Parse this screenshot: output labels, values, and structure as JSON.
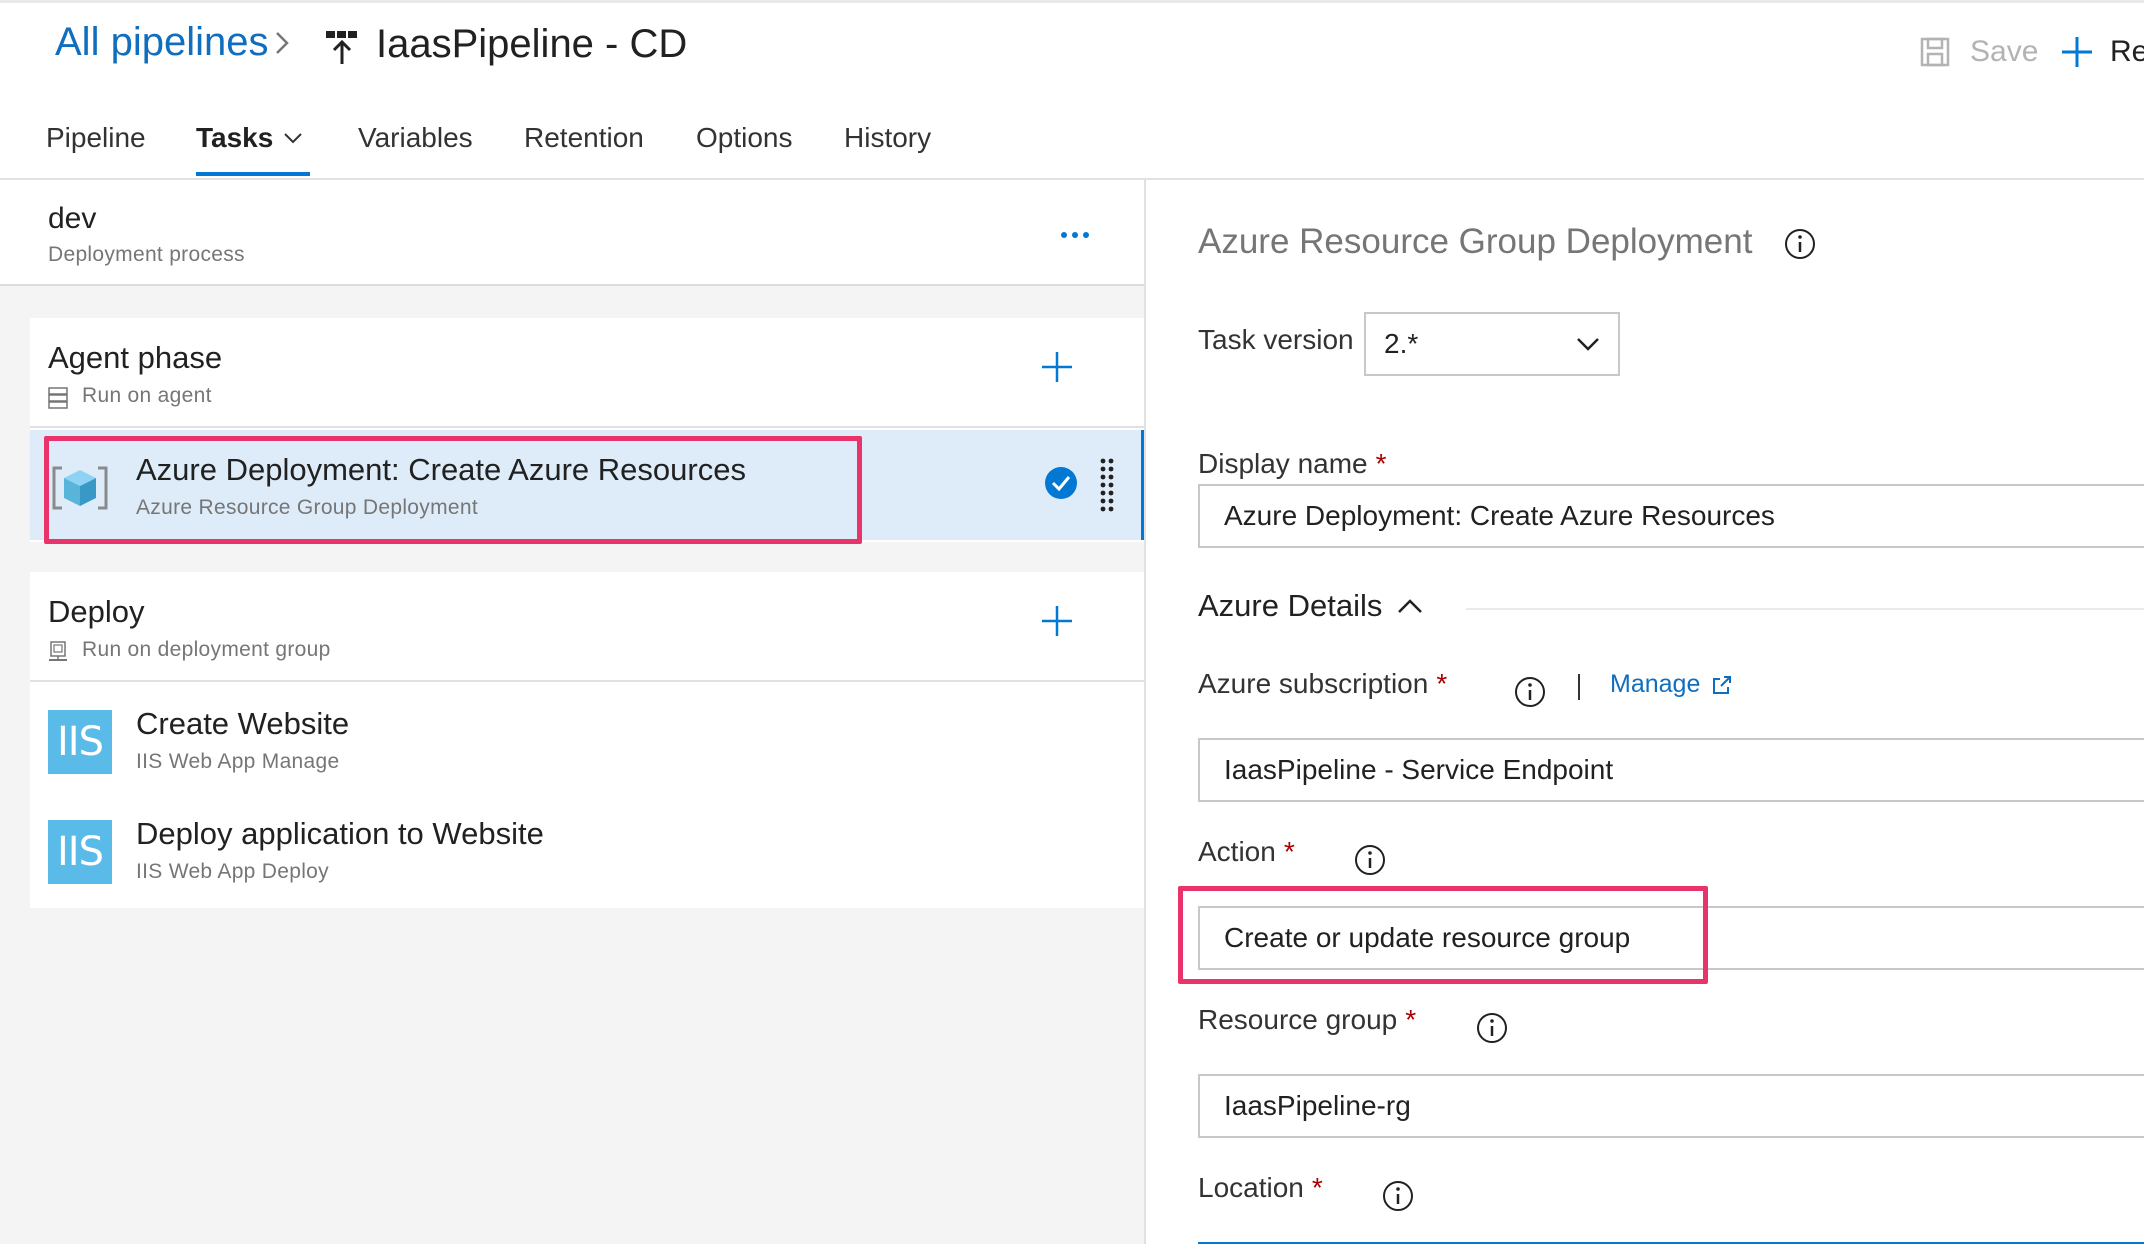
{
  "header": {
    "breadcrumb_link": "All pipelines",
    "pipeline_title": "IaasPipeline - CD",
    "save_label": "Save",
    "release_label": "Re"
  },
  "tabs": [
    "Pipeline",
    "Tasks",
    "Variables",
    "Retention",
    "Options",
    "History"
  ],
  "active_tab": "Tasks",
  "stage": {
    "name": "dev",
    "subtitle": "Deployment process"
  },
  "phases": [
    {
      "title": "Agent phase",
      "subtitle": "Run on agent",
      "tasks": [
        {
          "title": "Azure Deployment: Create Azure Resources",
          "subtitle": "Azure Resource Group Deployment",
          "selected": true
        }
      ]
    },
    {
      "title": "Deploy",
      "subtitle": "Run on deployment group",
      "tasks": [
        {
          "title": "Create Website",
          "subtitle": "IIS Web App Manage",
          "icon_text": "IIS"
        },
        {
          "title": "Deploy application to Website",
          "subtitle": "IIS Web App Deploy",
          "icon_text": "IIS"
        }
      ]
    }
  ],
  "details": {
    "title": "Azure Resource Group Deployment",
    "task_version_label": "Task version",
    "task_version_value": "2.*",
    "display_name_label": "Display name",
    "display_name_value": "Azure Deployment: Create Azure Resources",
    "section_title": "Azure Details",
    "subscription_label": "Azure subscription",
    "manage_label": "Manage",
    "subscription_value": "IaasPipeline - Service Endpoint",
    "action_label": "Action",
    "action_value": "Create or update resource group",
    "resource_group_label": "Resource group",
    "resource_group_value": "IaasPipeline-rg",
    "location_label": "Location",
    "required_marker": "*"
  },
  "colors": {
    "accent": "#0078d4",
    "link": "#106ebe",
    "highlight": "#e8336b",
    "selected_bg": "#deecf9",
    "iis_icon": "#5bbbe8"
  }
}
